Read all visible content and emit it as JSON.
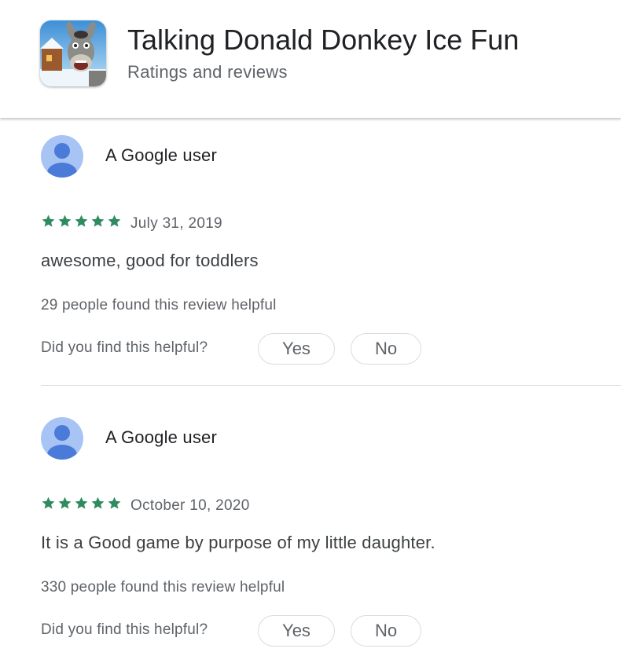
{
  "header": {
    "app_title": "Talking Donald Donkey Ice Fun",
    "subtitle": "Ratings and reviews"
  },
  "colors": {
    "star": "#2f8a5f",
    "avatar_bg": "#a8c4f5",
    "avatar_fg": "#4a7bd8",
    "divider": "#dadce0"
  },
  "reviews": [
    {
      "author": "A Google user",
      "rating": 5,
      "date": "July 31, 2019",
      "text": "awesome, good for toddlers",
      "helpful_count": "29 people found this review helpful",
      "helpful_question": "Did you find this helpful?",
      "yes_label": "Yes",
      "no_label": "No"
    },
    {
      "author": "A Google user",
      "rating": 5,
      "date": "October 10, 2020",
      "text": "It is a Good game by purpose of my little daughter.",
      "helpful_count": "330 people found this review helpful",
      "helpful_question": "Did you find this helpful?",
      "yes_label": "Yes",
      "no_label": "No"
    }
  ]
}
